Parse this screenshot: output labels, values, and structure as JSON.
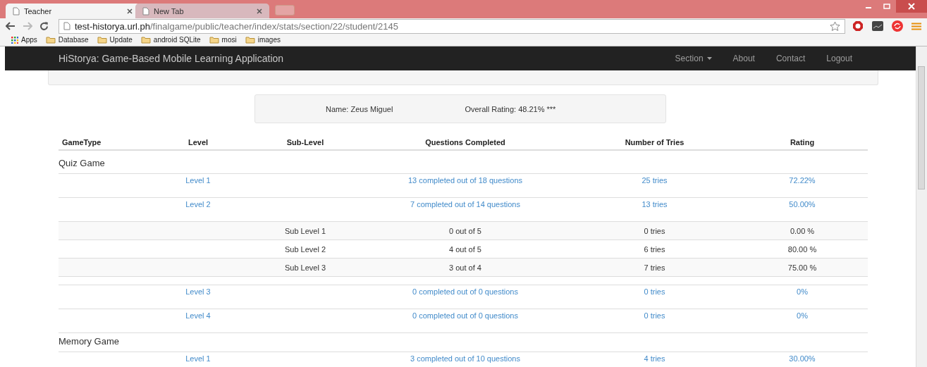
{
  "browser": {
    "tabs": [
      {
        "title": "Teacher",
        "selected": true
      },
      {
        "title": "New Tab",
        "selected": false
      }
    ],
    "url_host": "test-historya.url.ph",
    "url_path": "/finalgame/public/teacher/index/stats/section/22/student/2145",
    "bookmarks": [
      "Apps",
      "Database",
      "Update",
      "android SQLite",
      "mosi",
      "images"
    ]
  },
  "navbar": {
    "brand": "HiStorya: Game-Based Mobile Learning Application",
    "items": [
      {
        "label": "Section",
        "dropdown": true
      },
      {
        "label": "About",
        "dropdown": false
      },
      {
        "label": "Contact",
        "dropdown": false
      },
      {
        "label": "Logout",
        "dropdown": false
      }
    ]
  },
  "student": {
    "name": "Name: Zeus Miguel",
    "rating": "Overall Rating: 48.21% ***"
  },
  "table": {
    "columns": [
      "GameType",
      "Level",
      "Sub-Level",
      "Questions Completed",
      "Number of Tries",
      "Rating"
    ],
    "sections": [
      {
        "title": "Quiz Game",
        "rows": [
          {
            "kind": "level",
            "level": "Level 1",
            "questions": "13 completed out of 18 questions",
            "tries": "25 tries",
            "rating": "72.22%"
          },
          {
            "kind": "level",
            "level": "Level 2",
            "questions": "7 completed out of 14 questions",
            "tries": "13 tries",
            "rating": "50.00%"
          },
          {
            "kind": "sublevel",
            "sublevel": "Sub Level 1",
            "questions": "0 out of 5",
            "tries": "0 tries",
            "rating": "0.00 %"
          },
          {
            "kind": "sublevel",
            "sublevel": "Sub Level 2",
            "questions": "4 out of 5",
            "tries": "6 tries",
            "rating": "80.00 %"
          },
          {
            "kind": "sublevel",
            "sublevel": "Sub Level 3",
            "questions": "3 out of 4",
            "tries": "7 tries",
            "rating": "75.00 %"
          },
          {
            "kind": "level",
            "level": "Level 3",
            "questions": "0 completed out of 0 questions",
            "tries": "0 tries",
            "rating": "0%"
          },
          {
            "kind": "level",
            "level": "Level 4",
            "questions": "0 completed out of 0 questions",
            "tries": "0 tries",
            "rating": "0%"
          }
        ]
      },
      {
        "title": "Memory Game",
        "rows": [
          {
            "kind": "level",
            "level": "Level 1",
            "questions": "3 completed out of 10 questions",
            "tries": "4 tries",
            "rating": "30.00%"
          }
        ]
      }
    ]
  }
}
